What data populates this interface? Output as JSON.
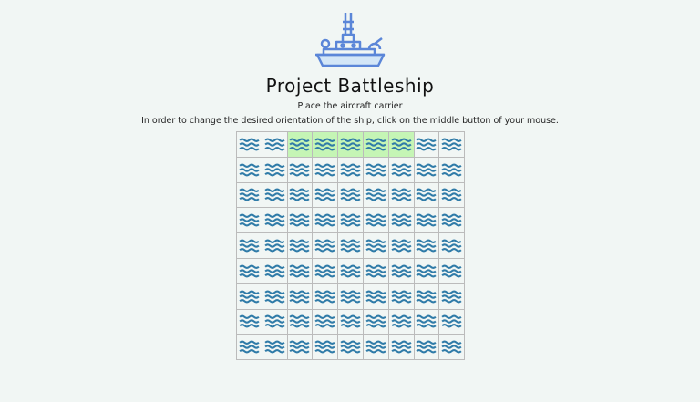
{
  "header": {
    "title": "Project Battleship",
    "logo_icon": "battleship-icon"
  },
  "instructions": {
    "line1": "Place the aircraft carrier",
    "line2": "In order to change the desired orientation of the ship, click on the middle button of your mouse."
  },
  "board": {
    "rows": 9,
    "cols": 9,
    "cell_icon": "waves-icon",
    "highlight_color": "#c5f5b5",
    "wave_color": "#2f7ba8",
    "highlighted_cells": [
      [
        0,
        2
      ],
      [
        0,
        3
      ],
      [
        0,
        4
      ],
      [
        0,
        5
      ],
      [
        0,
        6
      ]
    ]
  }
}
